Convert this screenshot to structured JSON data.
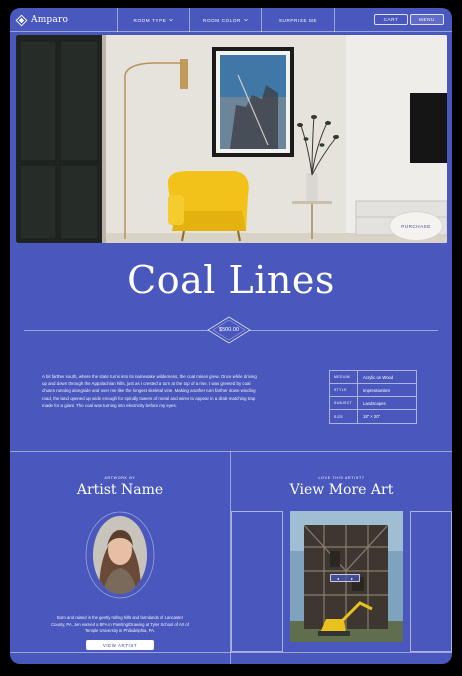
{
  "nav": {
    "logo_text": "Amparo",
    "room_type": "ROOM TYPE",
    "room_color": "ROOM COLOR",
    "surprise_me": "SURPRISE ME",
    "cart": "CART",
    "menu": "MENU"
  },
  "hero": {
    "purchase_label": "PURCHASE"
  },
  "artwork": {
    "title": "Coal Lines",
    "price": "$500.00",
    "description": "A bit farther south, where the state turns into its namesake wilderness, the coal mines grew. Once while driving up and down through the Appalachian hills, just as I crested a turn at the top of a rise, I was greeted by coal chutes running alongside and over me like the longest skeletal vine. Making another turn farther down winding road, the land opened up wide enough for spindly towers of metal and wires to appear in a drab-matching trap made for a giant. The coal was turning into electricity before my eyes.",
    "specs": [
      {
        "key": "MEDIUM",
        "value": "Acrylic on Wood"
      },
      {
        "key": "STYLE",
        "value": "Impressionism"
      },
      {
        "key": "SUBJECT",
        "value": "Landscapes"
      },
      {
        "key": "SIZE",
        "value": "18\" × 20\""
      }
    ]
  },
  "artist": {
    "eyebrow": "ARTWORK BY",
    "title": "Artist Name",
    "bio": "Born and raised in the gently rolling hills and farmlands of Lancaster County, PA, Jen earned a BFA in Painting/Drawing at Tyler School of Art of Temple University in Philadelphia, PA.",
    "button": "VIEW ARTIST"
  },
  "more": {
    "eyebrow": "LOVE THIS ARTIST?",
    "title": "View More Art",
    "prev": "◂",
    "next": "▸"
  },
  "colors": {
    "brand_blue": "#4a58bd",
    "chair_yellow": "#f2c21b"
  }
}
